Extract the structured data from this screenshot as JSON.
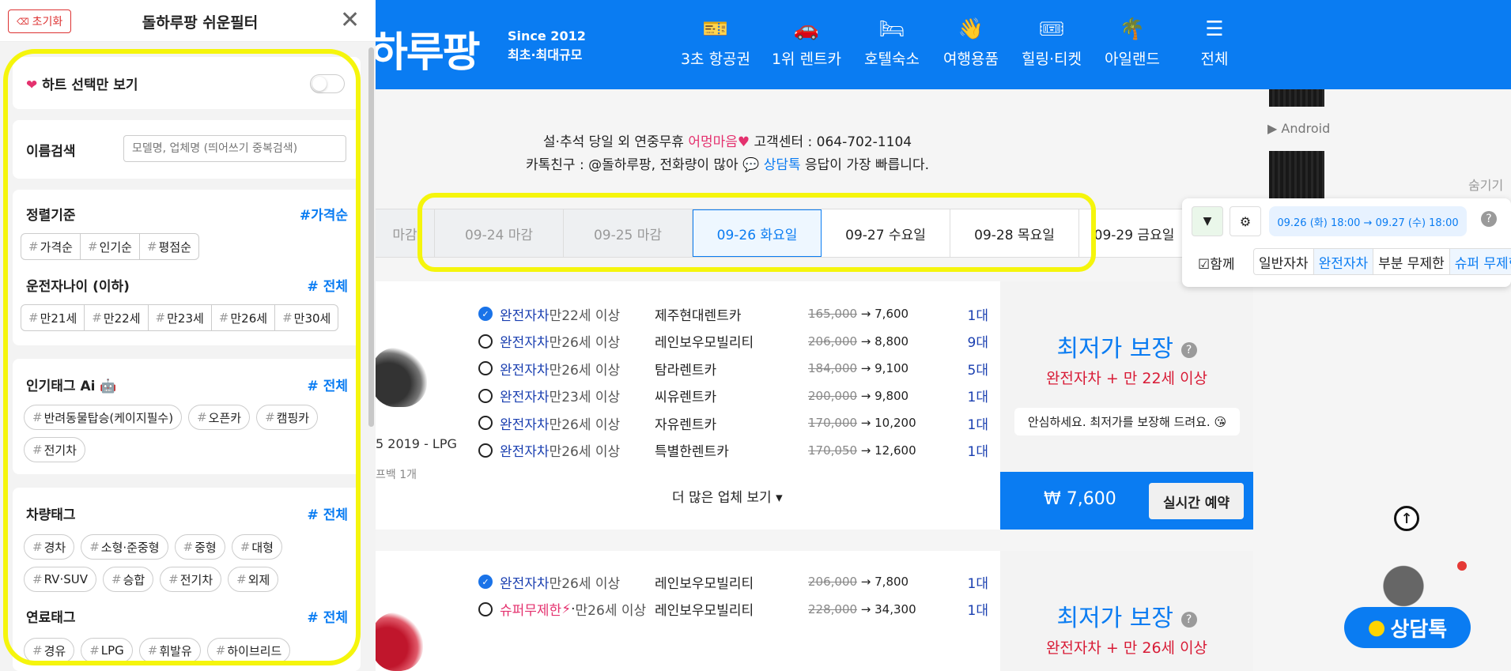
{
  "header": {
    "logo_text": "하루팡",
    "since": "Since 2012",
    "tagline": "최초·최대규모",
    "nav": [
      {
        "label": "3초 항공권",
        "icon": "ticket-icon"
      },
      {
        "label": "1위 렌트카",
        "icon": "car-icon"
      },
      {
        "label": "호텔숙소",
        "icon": "bed-icon"
      },
      {
        "label": "여행용품",
        "icon": "hand-icon"
      },
      {
        "label": "힐링·티켓",
        "icon": "coupon-icon"
      },
      {
        "label": "아일랜드",
        "icon": "palm-icon"
      },
      {
        "label": "전체",
        "icon": "menu-icon"
      }
    ]
  },
  "notice": {
    "line1_a": "설·추석 당일 외 연중무휴",
    "line1_pink": "어멍마음",
    "line1_b": "고객센터 : 064-702-1104",
    "line2_a": "카톡친구 : @돌하루팡, 전화량이 많아",
    "line2_blue": "상담톡",
    "line2_b": "응답이 가장 빠릅니다."
  },
  "date_tabs": [
    "마감",
    "09-24 마감",
    "09-25 마감",
    "09-26 화요일",
    "09-27 수요일",
    "09-28 목요일",
    "09-29 금요일"
  ],
  "listing1": {
    "car_name": "5 2019 - LPG",
    "car_note": "프백 1개",
    "rows": [
      {
        "type": "완전자차",
        "age": "만22세 이상",
        "company": "제주현대렌트카",
        "orig": "165,000",
        "price": "7,600",
        "count": "1대",
        "checked": true
      },
      {
        "type": "완전자차",
        "age": "만26세 이상",
        "company": "레인보우모빌리티",
        "orig": "206,000",
        "price": "8,800",
        "count": "9대",
        "checked": false
      },
      {
        "type": "완전자차",
        "age": "만26세 이상",
        "company": "탐라렌트카",
        "orig": "184,000",
        "price": "9,100",
        "count": "5대",
        "checked": false
      },
      {
        "type": "완전자차",
        "age": "만23세 이상",
        "company": "씨유렌트카",
        "orig": "200,000",
        "price": "9,800",
        "count": "1대",
        "checked": false
      },
      {
        "type": "완전자차",
        "age": "만26세 이상",
        "company": "자유렌트카",
        "orig": "170,000",
        "price": "10,200",
        "count": "1대",
        "checked": false
      },
      {
        "type": "완전자차",
        "age": "만26세 이상",
        "company": "특별한렌트카",
        "orig": "170,050",
        "price": "12,600",
        "count": "1대",
        "checked": false
      }
    ],
    "more": "더 많은 업체 보기",
    "guarantee_title": "최저가 보장",
    "guarantee_sub": "완전자차 + 만 22세 이상",
    "guarantee_msg": "안심하세요. 최저가를 보장해 드려요.",
    "price": "₩ 7,600",
    "book": "실시간 예약"
  },
  "listing2": {
    "rows": [
      {
        "type": "완전자차",
        "age": "만26세 이상",
        "company": "레인보우모빌리티",
        "orig": "206,000",
        "price": "7,800",
        "count": "1대",
        "checked": true
      },
      {
        "type": "슈퍼무제한",
        "age": "만26세 이상",
        "company": "레인보우모빌리티",
        "orig": "228,000",
        "price": "34,300",
        "count": "1대",
        "checked": false
      }
    ],
    "guarantee_title": "최저가 보장",
    "guarantee_sub": "완전자차 + 만 26세 이상"
  },
  "right": {
    "android": "Android",
    "hide": "숨기기",
    "date_range": "09.26 (화) 18:00 → 09.27 (수) 18:00",
    "together": "함께",
    "segments": [
      "일반자차",
      "완전자차",
      "부분 무제한",
      "슈퍼 무제한"
    ],
    "chat": "상담톡"
  },
  "filter": {
    "reset": "초기화",
    "title": "돌하루팡 쉬운필터",
    "heart_only": "하트 선택만 보기",
    "name_search": "이름검색",
    "search_placeholder": "모델명, 업체명 (띄어쓰기 중복검색)",
    "sort_title": "정렬기준",
    "sort_current": "가격순",
    "sort_tags": [
      "가격순",
      "인기순",
      "평점순"
    ],
    "age_title": "운전자나이 (이하)",
    "all": "전체",
    "age_tags": [
      "만21세",
      "만22세",
      "만23세",
      "만26세",
      "만30세"
    ],
    "pop_title": "인기태그 Ai",
    "pop_tags": [
      "반려동물탑승(케이지필수)",
      "오픈카",
      "캠핑카",
      "전기차"
    ],
    "car_title": "차량태그",
    "car_tags": [
      "경차",
      "소형·준중형",
      "중형",
      "대형",
      "RV·SUV",
      "승합",
      "전기차",
      "외제"
    ],
    "fuel_title": "연료태그",
    "fuel_tags": [
      "경유",
      "LPG",
      "휘발유",
      "하이브리드"
    ]
  },
  "colors": {
    "brand": "#0a7cf2",
    "highlight": "#f5f50c",
    "pink": "#e4316e"
  }
}
